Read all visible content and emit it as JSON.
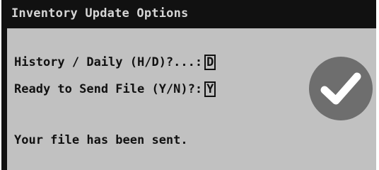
{
  "window": {
    "title": "Inventory Update Options"
  },
  "form": {
    "fields": [
      {
        "label": "History / Daily (H/D)?...:",
        "value": "D"
      },
      {
        "label": "Ready to Send File (Y/N)?:",
        "value": "Y"
      }
    ]
  },
  "status": {
    "message": "Your file has been sent.",
    "icon": "checkmark-circle-icon"
  },
  "colors": {
    "title_bar": "#111111",
    "title_text": "#d6d6d6",
    "panel_background": "#c1c1c1",
    "text": "#111111",
    "check_circle": "#6e6e6e"
  }
}
